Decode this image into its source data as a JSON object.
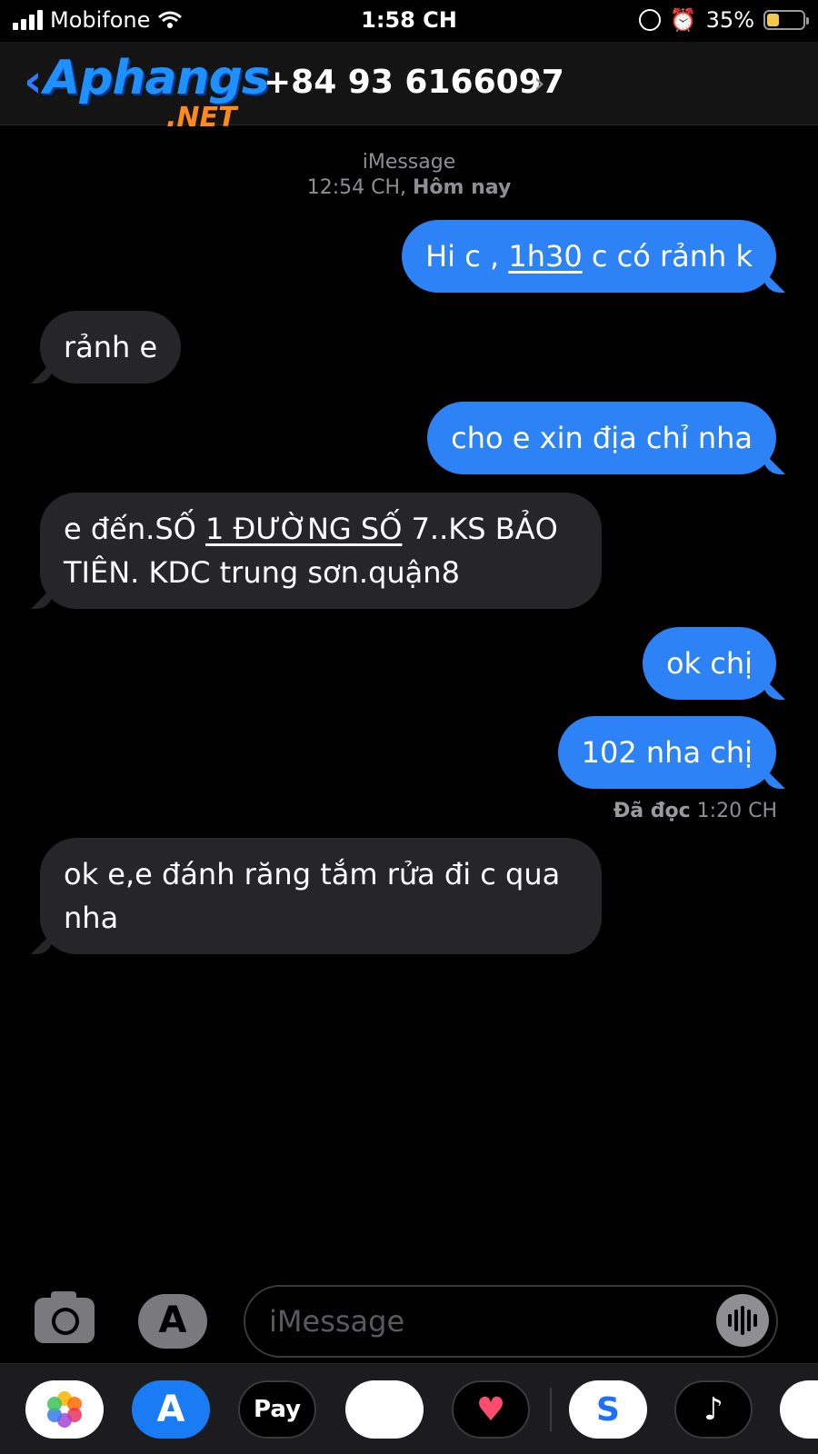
{
  "status_bar": {
    "carrier": "Mobifone",
    "time": "1:58 CH",
    "battery": "35%",
    "battery_level": 0.35
  },
  "header": {
    "logo_main": "Aphangs",
    "logo_suffix": ".NET",
    "contact": "+84 93 6166097"
  },
  "thread": {
    "service": "iMessage",
    "timestamp_time": "12:54 CH,",
    "timestamp_day": "Hôm nay",
    "messages": [
      {
        "text_a": "Hi c , ",
        "link": "1h30",
        "text_b": " c có rảnh k"
      },
      {
        "text": "rảnh e"
      },
      {
        "text": "cho e xin địa chỉ nha"
      },
      {
        "text_a": "e đến.SỐ ",
        "link": "1 ĐƯỜNG SỐ",
        "text_b": " 7..KS BẢO",
        "line2": "TIÊN. KDC trung sơn.quận8"
      },
      {
        "text": "ok chị"
      },
      {
        "text": "102 nha chị"
      },
      {
        "line1": "ok e,e đánh răng tắm rửa đi c qua",
        "line2": "nha"
      }
    ],
    "read_label": "Đã đọc",
    "read_time": "1:20 CH"
  },
  "input": {
    "placeholder": "iMessage"
  },
  "drawer": {
    "apple_pay_label": "Pay"
  },
  "colors": {
    "outgoing_bubble": "#2d82f5",
    "incoming_bubble": "#262628",
    "background": "#000000"
  }
}
